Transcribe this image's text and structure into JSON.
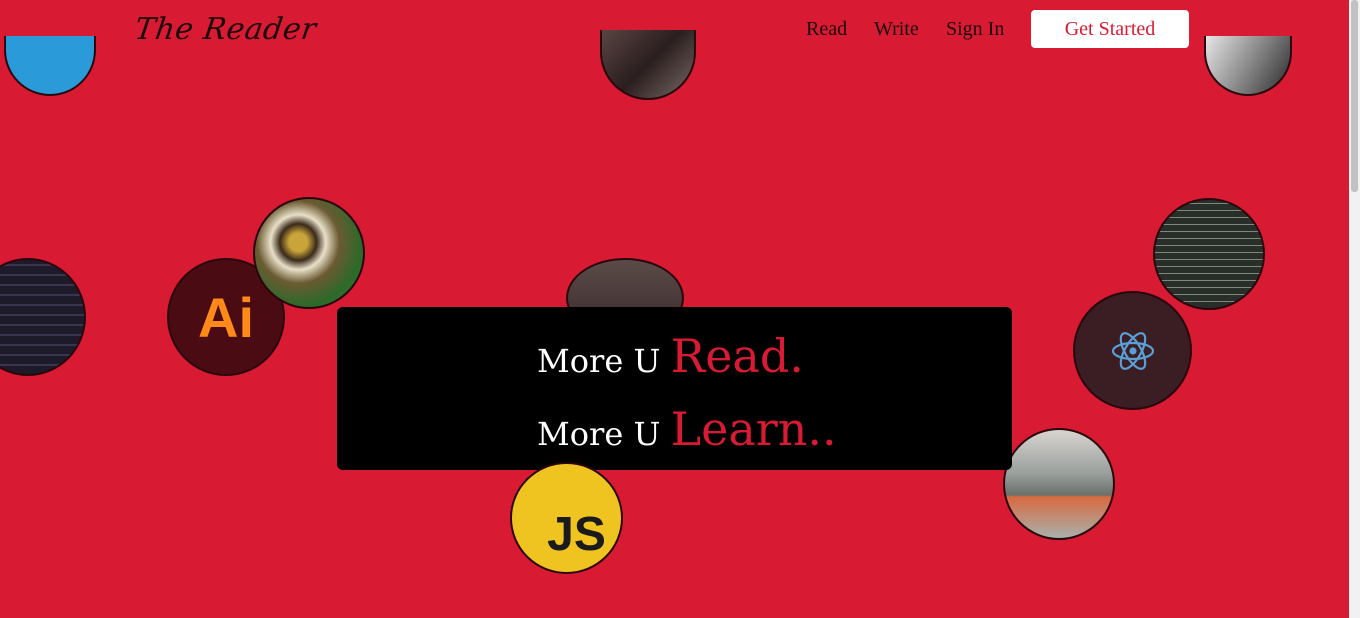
{
  "header": {
    "logo": "The Reader",
    "nav": [
      "Read",
      "Write",
      "Sign In"
    ],
    "cta_label": "Get Started"
  },
  "hero": {
    "line1_prefix": "More U ",
    "line1_accent": "Read.",
    "line2_prefix": "More U ",
    "line2_accent": "Learn.."
  },
  "bubbles": {
    "ai_text": "Ai",
    "js_text": "JS"
  },
  "colors": {
    "background": "#d91a33",
    "hero_box": "#000000",
    "accent": "#d91a33",
    "cta_bg": "#ffffff"
  },
  "icons": [
    "adobe-illustrator-icon",
    "javascript-icon",
    "react-icon"
  ]
}
